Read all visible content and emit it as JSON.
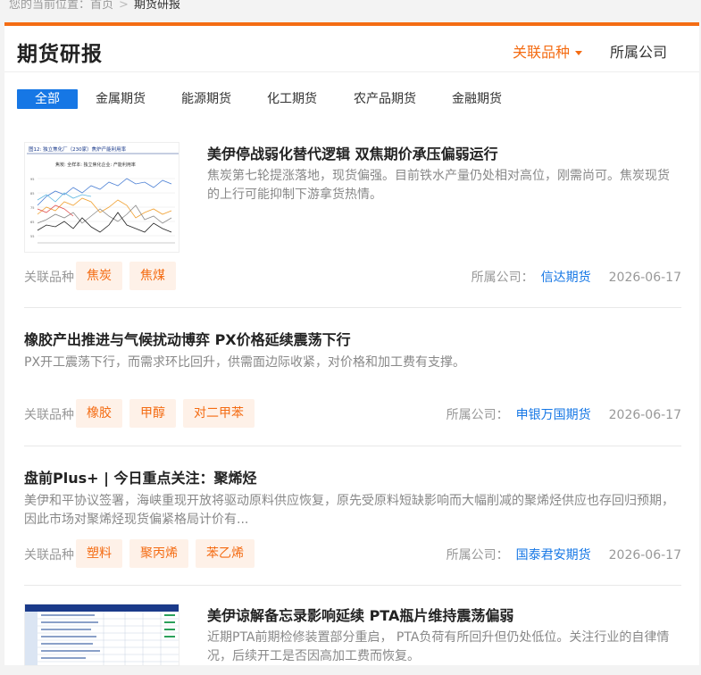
{
  "breadcrumb": {
    "prefix": "您的当前位置：",
    "home": "首页",
    "sep": ">",
    "current": "期货研报"
  },
  "header": {
    "title": "期货研报",
    "filter_variety": "关联品种",
    "filter_company": "所属公司"
  },
  "tabs": [
    "全部",
    "金属期货",
    "能源期货",
    "化工期货",
    "农产品期货",
    "金融期货"
  ],
  "labels": {
    "related": "关联品种",
    "company": "所属公司："
  },
  "colors": {
    "accent": "#f46c13",
    "link": "#1677e5",
    "tag_bg": "#fef1e8"
  },
  "articles": [
    {
      "title": "美伊停战弱化替代逻辑 双焦期价承压偏弱运行",
      "summary": "焦炭第七轮提涨落地，现货偏强。目前铁水产量仍处相对高位，刚需尚可。焦炭现货的上行可能抑制下游拿货热情。",
      "tags": [
        "焦炭",
        "焦煤"
      ],
      "company": "信达期货",
      "date": "2026-06-17",
      "thumb": {
        "caption": "图12: 独立焦化厂（230家）焦炉产能利用率",
        "chart_title": "焦炭: 全样本: 独立焦化企业: 产能利用率"
      }
    },
    {
      "title": "橡胶产出推进与气候扰动博弈 PX价格延续震荡下行",
      "summary": "PX开工震荡下行，而需求环比回升，供需面边际收紧，对价格和加工费有支撑。",
      "tags": [
        "橡胶",
        "甲醇",
        "对二甲苯"
      ],
      "company": "申银万国期货",
      "date": "2026-06-17"
    },
    {
      "title": "盘前Plus+ | 今日重点关注：聚烯烃",
      "summary": "美伊和平协议签署，海峡重现开放将驱动原料供应恢复，原先受原料短缺影响而大幅削减的聚烯烃供应也存回归预期，因此市场对聚烯烃现货偏紧格局计价有...",
      "tags": [
        "塑料",
        "聚丙烯",
        "苯乙烯"
      ],
      "company": "国泰君安期货",
      "date": "2026-06-17"
    },
    {
      "title": "美伊谅解备忘录影响延续 PTA瓶片维持震荡偏弱",
      "summary": "近期PTA前期检修装置部分重启， PTA负荷有所回升但仍处低位。关注行业的自律情况，后续开工是否因高加工费而恢复。"
    }
  ]
}
